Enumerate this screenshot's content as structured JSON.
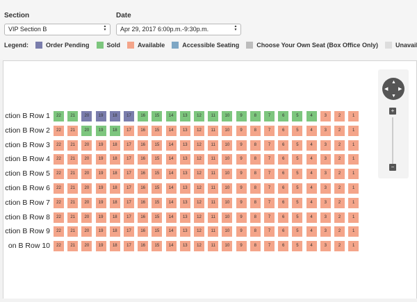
{
  "filters": {
    "section": {
      "label": "Section",
      "value": "VIP Section B"
    },
    "date": {
      "label": "Date",
      "value": "Apr 29, 2017 6:00p.m.-9:30p.m."
    }
  },
  "legend": {
    "title": "Legend:",
    "items": [
      {
        "label": "Order Pending",
        "color": "#7a7dac",
        "icon": "square"
      },
      {
        "label": "Sold",
        "color": "#7dc67e",
        "icon": "square"
      },
      {
        "label": "Available",
        "color": "#f4a58a",
        "icon": "square"
      },
      {
        "label": "Accessible Seating",
        "color": "#7fa7c4",
        "icon": "square"
      },
      {
        "label": "Choose Your Own Seat (Box Office Only)",
        "color": "#bdbdbd",
        "icon": "square"
      },
      {
        "label": "Unavailable",
        "color": "#dddddd",
        "icon": "square"
      }
    ]
  },
  "seat_map": {
    "seat_numbers": [
      "22",
      "21",
      "20",
      "19",
      "18",
      "17",
      "16",
      "15",
      "14",
      "13",
      "12",
      "11",
      "10",
      "9",
      "8",
      "7",
      "6",
      "5",
      "4",
      "3",
      "2",
      "1"
    ],
    "rows": [
      {
        "label": "ction B Row 1",
        "statuses": [
          "sold",
          "sold",
          "pending",
          "pending",
          "pending",
          "pending",
          "sold",
          "sold",
          "sold",
          "sold",
          "sold",
          "sold",
          "sold",
          "sold",
          "sold",
          "sold",
          "sold",
          "sold",
          "sold",
          "available",
          "available",
          "available"
        ]
      },
      {
        "label": "ction B Row 2",
        "statuses": [
          "available",
          "available",
          "sold",
          "sold",
          "sold",
          "available",
          "available",
          "available",
          "available",
          "available",
          "available",
          "available",
          "available",
          "available",
          "available",
          "available",
          "available",
          "available",
          "available",
          "available",
          "available",
          "available"
        ]
      },
      {
        "label": "ction B Row 3",
        "statuses": [
          "available",
          "available",
          "available",
          "available",
          "available",
          "available",
          "available",
          "available",
          "available",
          "available",
          "available",
          "available",
          "available",
          "available",
          "available",
          "available",
          "available",
          "available",
          "available",
          "available",
          "available",
          "available"
        ]
      },
      {
        "label": "ction B Row 4",
        "statuses": [
          "available",
          "available",
          "available",
          "available",
          "available",
          "available",
          "available",
          "available",
          "available",
          "available",
          "available",
          "available",
          "available",
          "available",
          "available",
          "available",
          "available",
          "available",
          "available",
          "available",
          "available",
          "available"
        ]
      },
      {
        "label": "ction B Row 5",
        "statuses": [
          "available",
          "available",
          "available",
          "available",
          "available",
          "available",
          "available",
          "available",
          "available",
          "available",
          "available",
          "available",
          "available",
          "available",
          "available",
          "available",
          "available",
          "available",
          "available",
          "available",
          "available",
          "available"
        ]
      },
      {
        "label": "ction B Row 6",
        "statuses": [
          "available",
          "available",
          "available",
          "available",
          "available",
          "available",
          "available",
          "available",
          "available",
          "available",
          "available",
          "available",
          "available",
          "available",
          "available",
          "available",
          "available",
          "available",
          "available",
          "available",
          "available",
          "available"
        ]
      },
      {
        "label": "ction B Row 7",
        "statuses": [
          "available",
          "available",
          "available",
          "available",
          "available",
          "available",
          "available",
          "available",
          "available",
          "available",
          "available",
          "available",
          "available",
          "available",
          "available",
          "available",
          "available",
          "available",
          "available",
          "available",
          "available",
          "available"
        ]
      },
      {
        "label": "ction B Row 8",
        "statuses": [
          "available",
          "available",
          "available",
          "available",
          "available",
          "available",
          "available",
          "available",
          "available",
          "available",
          "available",
          "available",
          "available",
          "available",
          "available",
          "available",
          "available",
          "available",
          "available",
          "available",
          "available",
          "available"
        ]
      },
      {
        "label": "ction B Row 9",
        "statuses": [
          "available",
          "available",
          "available",
          "available",
          "available",
          "available",
          "available",
          "available",
          "available",
          "available",
          "available",
          "available",
          "available",
          "available",
          "available",
          "available",
          "available",
          "available",
          "available",
          "available",
          "available",
          "available"
        ]
      },
      {
        "label": "on B Row 10",
        "statuses": [
          "available",
          "available",
          "available",
          "available",
          "available",
          "available",
          "available",
          "available",
          "available",
          "available",
          "available",
          "available",
          "available",
          "available",
          "available",
          "available",
          "available",
          "available",
          "available",
          "available",
          "available",
          "available"
        ]
      }
    ]
  },
  "zoom_controls": {
    "pan_icon": "pan-arrows-icon",
    "zoom_in_label": "+",
    "zoom_out_label": "−"
  }
}
